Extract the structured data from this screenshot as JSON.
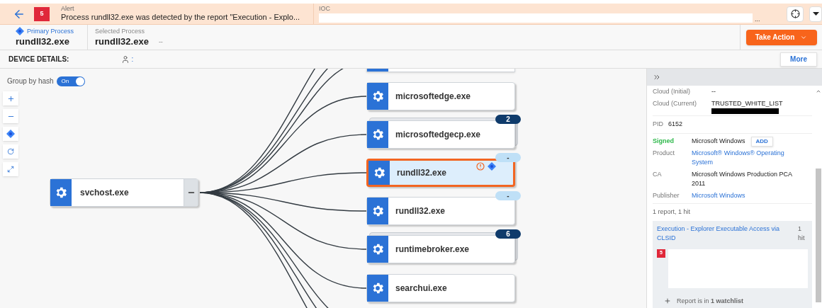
{
  "alert": {
    "severity": "5",
    "label": "Alert",
    "text": "Process rundll32.exe was detected by the report \"Execution - Explo..."
  },
  "ioc": {
    "label": "IOC",
    "overflow": "..."
  },
  "process_header": {
    "primary_label": "Primary Process",
    "primary_value": "rundll32.exe",
    "selected_label": "Selected Process",
    "selected_value": "rundll32.exe",
    "selected_extra": "--"
  },
  "take_action": "Take Action",
  "device_details": {
    "label": "DEVICE DETAILS:",
    "user_text": ":"
  },
  "more_button": "More",
  "group_by_hash": {
    "label": "Group by hash",
    "on": true,
    "toggle_text": "On"
  },
  "graph": {
    "root": {
      "name": "svchost.exe",
      "expanded": true
    },
    "children": [
      {
        "name": "microsoftedge.exe",
        "grouped": false,
        "selected": false,
        "alert": false,
        "primary": false
      },
      {
        "name": "microsoftedgecp.exe",
        "count": "2",
        "grouped": true,
        "selected": false,
        "alert": false,
        "primary": false
      },
      {
        "name": "rundll32.exe",
        "count": "-",
        "grouped": false,
        "selected": true,
        "alert": true,
        "primary": true
      },
      {
        "name": "rundll32.exe",
        "count": "-",
        "grouped": false,
        "selected": false,
        "alert": false,
        "primary": false
      },
      {
        "name": "runtimebroker.exe",
        "count": "6",
        "grouped": true,
        "selected": false,
        "alert": false,
        "primary": false
      },
      {
        "name": "searchui.exe",
        "grouped": false,
        "selected": false,
        "alert": false,
        "primary": false
      }
    ]
  },
  "details": {
    "cloud": [
      {
        "label": "Cloud (Initial)",
        "value": "--",
        "redacted": false
      },
      {
        "label": "Cloud (Current)",
        "value": "TRUSTED_WHITE_LIST",
        "redacted": true
      }
    ],
    "pid": {
      "label": "PID",
      "value": "6152"
    },
    "signature": [
      {
        "label": "Signed",
        "value": "Microsoft Windows",
        "kind": "status",
        "button": "ADD"
      },
      {
        "label": "Product",
        "value": "Microsoft® Windows® Operating System",
        "kind": "link"
      },
      {
        "label": "CA",
        "value": "Microsoft Windows Production PCA 2011",
        "kind": "text"
      },
      {
        "label": "Publisher",
        "value": "Microsoft Windows",
        "kind": "link"
      }
    ],
    "reports_summary": "1 report, 1 hit",
    "report": {
      "title": "Execution - Explorer Executable Access via CLSID",
      "hits": "1 hit",
      "severity": "5",
      "watchlist": "Report is in **1 watchlist**"
    }
  }
}
